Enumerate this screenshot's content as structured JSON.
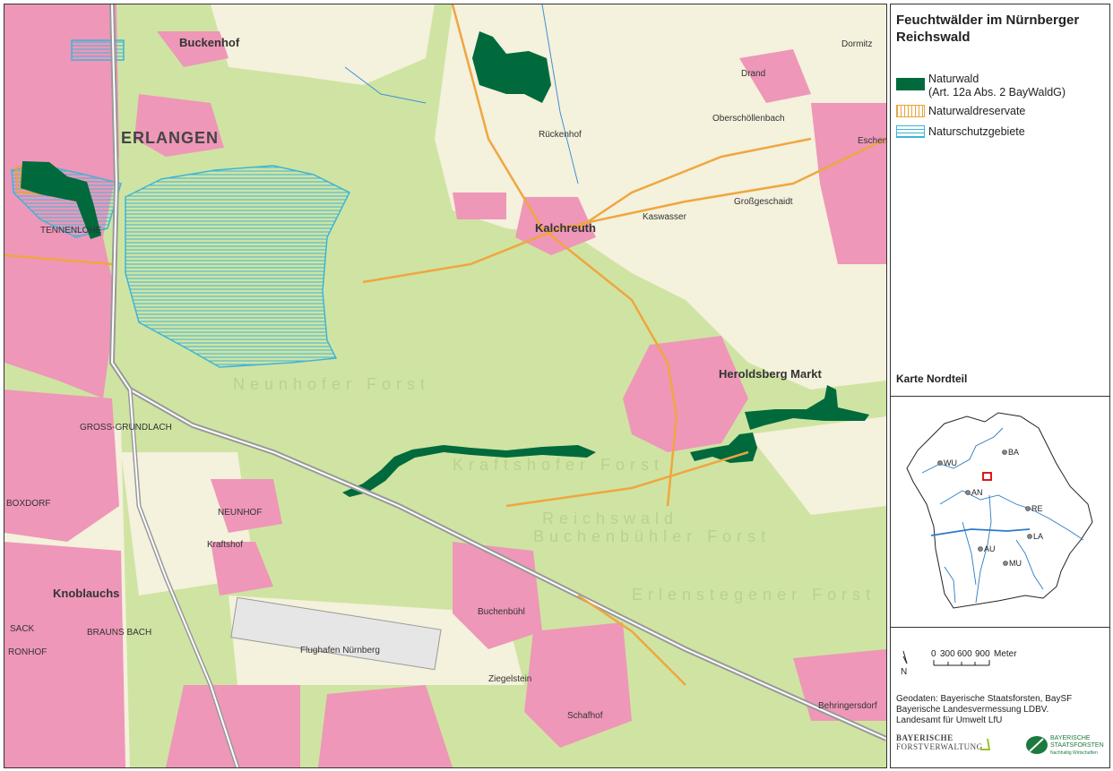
{
  "map": {
    "places": [
      {
        "name": "ERLANGEN",
        "size": "big"
      },
      {
        "name": "Buckenhof",
        "size": "mid"
      },
      {
        "name": "Kalchreuth",
        "size": "mid"
      },
      {
        "name": "Heroldsberg Markt",
        "size": "mid"
      },
      {
        "name": "GROSS-GRUNDLACH",
        "size": "small"
      },
      {
        "name": "BOXDORF",
        "size": "small"
      },
      {
        "name": "NEUNHOF",
        "size": "small"
      },
      {
        "name": "Kraftshof",
        "size": "small"
      },
      {
        "name": "Knoblauchs",
        "size": "mid"
      },
      {
        "name": "SACK",
        "size": "small"
      },
      {
        "name": "BRAUNS BACH",
        "size": "small"
      },
      {
        "name": "RONHOF",
        "size": "small"
      },
      {
        "name": "Buchenbühl",
        "size": "small"
      },
      {
        "name": "Flughafen Nürnberg",
        "size": "small"
      },
      {
        "name": "Ziegelstein",
        "size": "small"
      },
      {
        "name": "Behringersdorf",
        "size": "small"
      },
      {
        "name": "Schafhof",
        "size": "small"
      },
      {
        "name": "Dormitz",
        "size": "small"
      },
      {
        "name": "Drand",
        "size": "small"
      },
      {
        "name": "Oberschöllenbach",
        "size": "small"
      },
      {
        "name": "Rückenhof",
        "size": "small"
      },
      {
        "name": "Kaswasser",
        "size": "small"
      },
      {
        "name": "Großgeschaidt",
        "size": "small"
      },
      {
        "name": "TENNENLOHE",
        "size": "small"
      },
      {
        "name": "Eschenau",
        "size": "small"
      },
      {
        "name": "Reichswald",
        "size": "forest"
      },
      {
        "name": "Neunhofer Forst",
        "size": "forest"
      },
      {
        "name": "Kraftshofer Forst",
        "size": "forest"
      },
      {
        "name": "Erlenstegener Forst",
        "size": "forest"
      },
      {
        "name": "Buchenbühler Forst",
        "size": "forest"
      }
    ]
  },
  "legend": {
    "title": "Feuchtwälder im Nürnberger Reichswald",
    "items": [
      {
        "label_line1": "Naturwald",
        "label_line2": "(Art. 12a Abs. 2 BayWaldG)",
        "fill": "#006a3c",
        "style": "solid"
      },
      {
        "label_line1": "Naturwaldreservate",
        "label_line2": "",
        "fill": "#e8a33a",
        "style": "vertical-hatch"
      },
      {
        "label_line1": "Naturschutzgebiete",
        "label_line2": "",
        "fill": "#3fb4d8",
        "style": "horizontal-hatch"
      }
    ],
    "subtitle": "Karte Nordteil"
  },
  "inset": {
    "cities": [
      "BA",
      "WU",
      "AN",
      "RE",
      "LA",
      "AU",
      "MU"
    ],
    "highlight_color": "#dd0000"
  },
  "scale": {
    "north": "N",
    "labels": [
      "0",
      "300",
      "600",
      "900",
      "Meter"
    ]
  },
  "credits": [
    "Geodaten: Bayerische Staatsforsten, BaySF",
    "Bayerische Landesvermessung LDBV.",
    "Landesamt für Umwelt LfU"
  ],
  "logos": {
    "left": [
      "BAYERISCHE",
      "FORSTVERWALTUNG"
    ],
    "right": [
      "BAYERISCHE",
      "STAATSFORSTEN",
      "Nachhaltig Wirtschaften"
    ]
  },
  "colors": {
    "forest": "#cfe4a2",
    "open_land": "#f4f1dc",
    "settlement": "#ee97b8",
    "naturwald": "#006a3c",
    "nsg": "#3fb4d8"
  }
}
